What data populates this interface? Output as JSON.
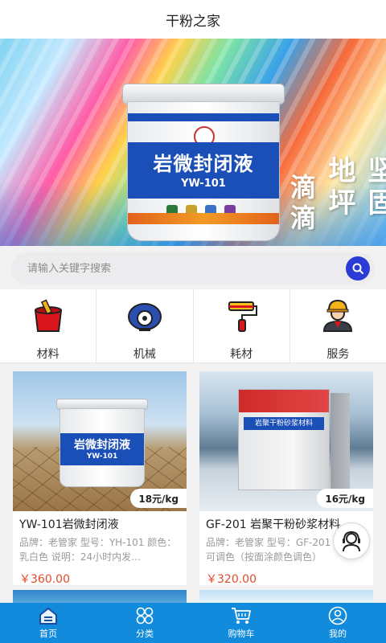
{
  "header": {
    "title": "干粉之家"
  },
  "banner": {
    "product_title": "岩微封闭液",
    "product_model": "YW-101",
    "slogan_right": "坚固地坪",
    "slogan_left": "滴滴"
  },
  "search": {
    "placeholder": "请输入关键字搜索"
  },
  "categories": [
    {
      "label": "材料",
      "icon": "paint-bucket-icon"
    },
    {
      "label": "机械",
      "icon": "grinder-machine-icon"
    },
    {
      "label": "耗材",
      "icon": "paint-roller-icon"
    },
    {
      "label": "服务",
      "icon": "worker-helmet-icon"
    }
  ],
  "products": [
    {
      "name": "YW-101岩微封闭液",
      "desc": "品牌：老管家 型号：YH-101 颜色：乳白色 说明：24小时内发…",
      "price": "￥360.00",
      "unit_price": "18元/kg",
      "image_title": "岩微封闭液",
      "image_model": "YW-101"
    },
    {
      "name": "GF-201 岩聚干粉砂浆材料",
      "desc": "品牌：老管家 型号：GF-201 颜色：可调色（按面涂颜色调色）",
      "price": "￥320.00",
      "unit_price": "16元/kg",
      "image_title": "岩聚干粉砂浆材料"
    }
  ],
  "tabbar": [
    {
      "label": "首页",
      "icon": "home-icon",
      "active": true
    },
    {
      "label": "分类",
      "icon": "category-icon",
      "active": false
    },
    {
      "label": "购物车",
      "icon": "cart-icon",
      "active": false
    },
    {
      "label": "我的",
      "icon": "user-icon",
      "active": false
    }
  ],
  "colors": {
    "accent": "#128bdc",
    "price": "#e24b2b",
    "search_button": "#2a3bd6"
  }
}
